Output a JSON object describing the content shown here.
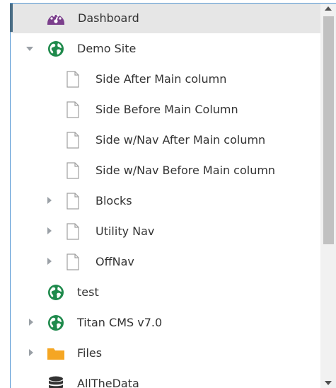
{
  "tree": {
    "items": [
      {
        "label": "Dashboard",
        "icon": "dashboard-gauge-icon",
        "state": "selected"
      },
      {
        "label": "Demo Site",
        "icon": "globe-icon",
        "state": "expanded"
      },
      {
        "label": "Side After Main column",
        "icon": "page-icon"
      },
      {
        "label": "Side Before Main Column",
        "icon": "page-icon"
      },
      {
        "label": "Side w/Nav After Main column",
        "icon": "page-icon"
      },
      {
        "label": "Side w/Nav Before Main column",
        "icon": "page-icon"
      },
      {
        "label": "Blocks",
        "icon": "page-icon",
        "state": "collapsed"
      },
      {
        "label": "Utility Nav",
        "icon": "page-icon",
        "state": "collapsed"
      },
      {
        "label": "OffNav",
        "icon": "page-icon",
        "state": "collapsed"
      },
      {
        "label": "test",
        "icon": "globe-icon"
      },
      {
        "label": "Titan CMS v7.0",
        "icon": "globe-icon",
        "state": "collapsed"
      },
      {
        "label": "Files",
        "icon": "folder-icon",
        "state": "collapsed"
      },
      {
        "label": "AllTheData",
        "icon": "database-icon"
      }
    ]
  },
  "colors": {
    "selected_row": "#e6e6e6",
    "dashboard_icon": "#7b3f8c",
    "globe_icon": "#1f8a4c",
    "folder_icon": "#f5a623",
    "database_icon": "#333333",
    "focus_border": "#5b9bd5"
  }
}
